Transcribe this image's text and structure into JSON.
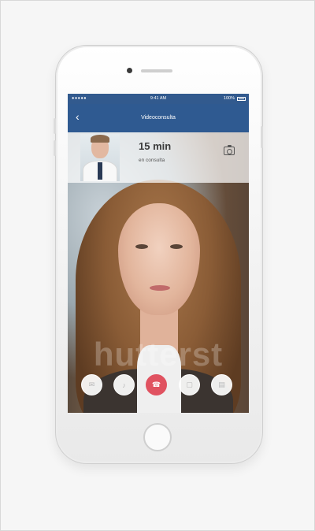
{
  "status_bar": {
    "carrier_signal": "●●●●● ",
    "time": "9:41 AM",
    "battery": "100%"
  },
  "nav": {
    "back_icon": "chevron-left",
    "title": "Videoconsulta"
  },
  "call": {
    "duration": "15 min",
    "duration_label": "en consulta"
  },
  "watermark": "hutterst",
  "controls": [
    {
      "icon": "chat-icon",
      "glyph": "✉"
    },
    {
      "icon": "microphone-icon",
      "glyph": "♪"
    },
    {
      "icon": "end-call-icon",
      "glyph": "☎"
    },
    {
      "icon": "file-icon",
      "glyph": "▢"
    },
    {
      "icon": "document-icon",
      "glyph": "▤"
    }
  ],
  "colors": {
    "nav_bar": "#2f5a91",
    "end_call": "#e05260"
  }
}
